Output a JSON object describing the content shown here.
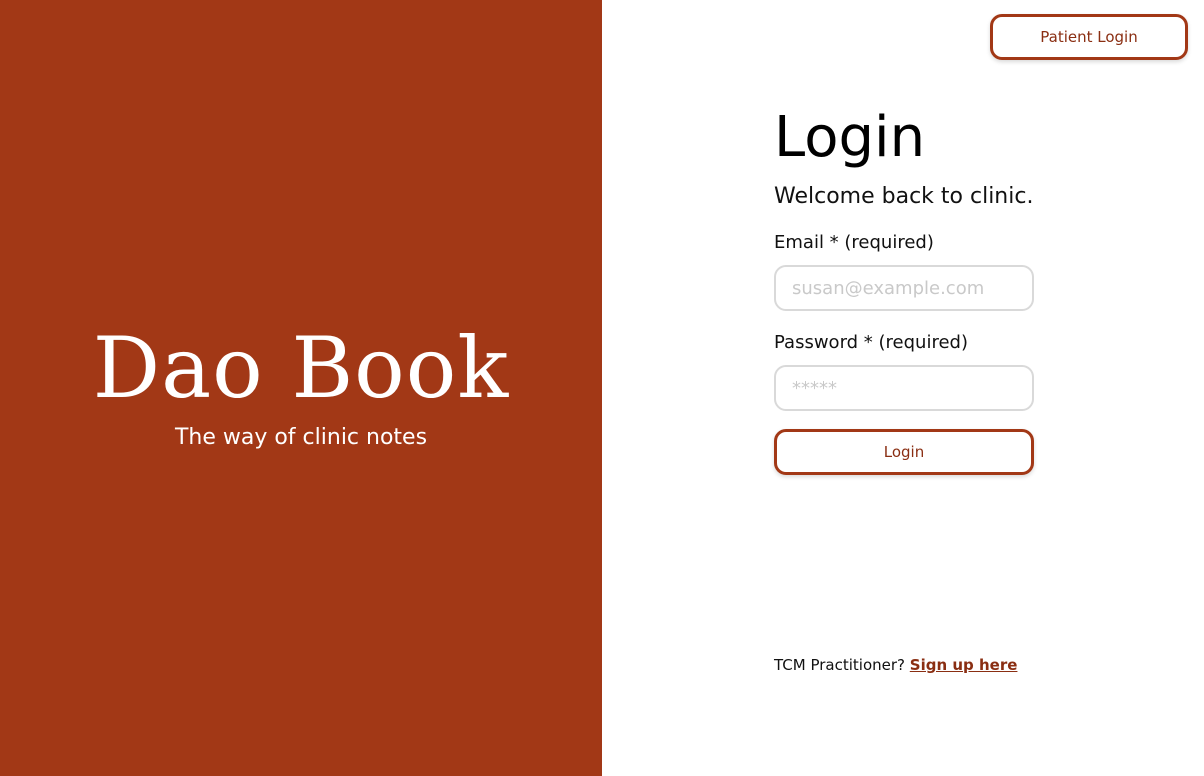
{
  "brand": {
    "title": "Dao Book",
    "tagline": "The way of clinic notes"
  },
  "header": {
    "patient_login_label": "Patient Login"
  },
  "form": {
    "title": "Login",
    "subtitle": "Welcome back to clinic.",
    "email": {
      "label": "Email * (required)",
      "placeholder": "susan@example.com",
      "value": ""
    },
    "password": {
      "label": "Password * (required)",
      "placeholder": "*****",
      "value": ""
    },
    "submit_label": "Login"
  },
  "footer": {
    "prompt": "TCM Practitioner?",
    "link_label": "Sign up here"
  },
  "colors": {
    "brand_panel": "#a23816",
    "accent_text": "#8a2e12",
    "input_border": "#d9d9d9"
  }
}
